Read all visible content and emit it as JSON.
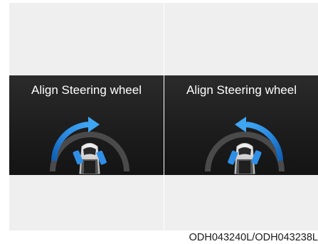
{
  "panels": [
    {
      "title": "Align Steering wheel",
      "arrow_direction": "clockwise"
    },
    {
      "title": "Align Steering wheel",
      "arrow_direction": "counterclockwise"
    }
  ],
  "icons": {
    "arc_arrow": "curved-arrow-icon",
    "car": "car-icon",
    "wheels": "front-wheel-icon"
  },
  "colors": {
    "screen_background": "#1d1d1d",
    "arrow_blue_light": "#3fa6f3",
    "arrow_blue_dark": "#0e5fb4",
    "track_gray": "#4a4a4a",
    "text": "#ffffff"
  },
  "caption": "ODH043240L/ODH043238L"
}
